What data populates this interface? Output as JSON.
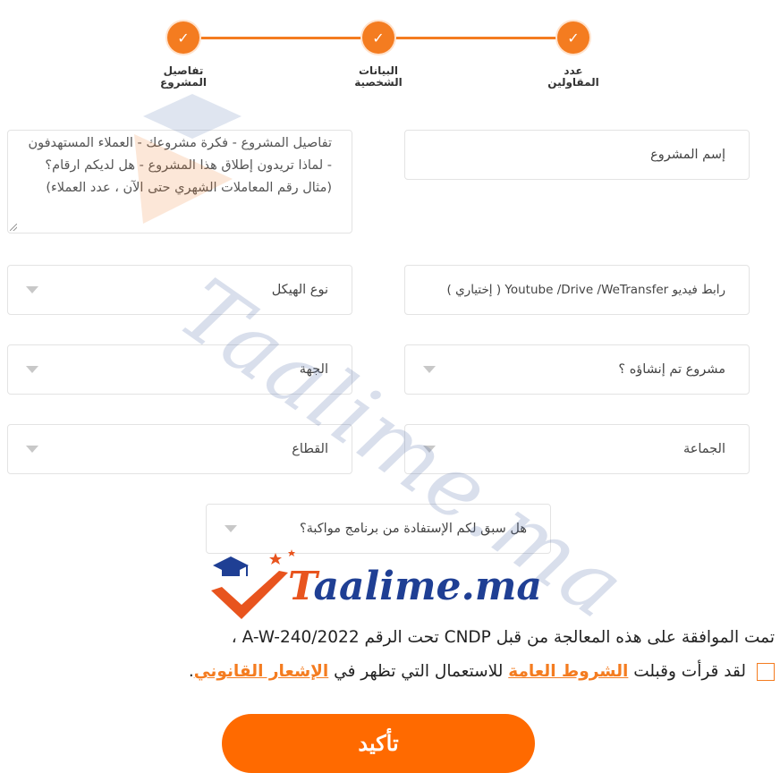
{
  "stepper": {
    "steps": [
      {
        "label": "تفاصيل\nالمشروع",
        "status": "done"
      },
      {
        "label": "البيانات\nالشخصية",
        "status": "done"
      },
      {
        "label": "عدد\nالمقاولين",
        "status": "done"
      }
    ],
    "check_glyph": "✓",
    "accent": "#f47c20"
  },
  "form": {
    "project_name": {
      "placeholder": "إسم المشروع"
    },
    "project_details": {
      "placeholder": "تفاصيل المشروع - فكرة مشروعك - العملاء المستهدفون - لماذا تريدون إطلاق هذا المشروع - هل لديكم ارقام؟ (مثال رقم المعاملات الشهري حتى الآن ، عدد العملاء)"
    },
    "video_link": {
      "placeholder": "رابط فيديو Youtube /Drive /WeTransfer ( إختياري )"
    },
    "structure_type": {
      "value": "نوع الهيكل"
    },
    "project_created": {
      "value": "مشروع تم إنشاؤه ؟"
    },
    "region": {
      "value": "الجهة"
    },
    "commune": {
      "value": "الجماعة"
    },
    "sector": {
      "value": "القطاع"
    },
    "mentoring": {
      "value": "هل سبق لكم الإستفادة من برنامج مواكبة؟"
    }
  },
  "logo": {
    "text_first": "T",
    "text_rest": "aalime.ma",
    "brand_blue": "#1f3f94",
    "brand_orange": "#e8541e"
  },
  "watermark": {
    "text": "Taalime.ma"
  },
  "agreement": {
    "cndp_text": "تمت الموافقة على هذه المعالجة من قبل CNDP تحت الرقم A-W-240/2022 ،",
    "read_accept": "لقد قرأت وقبلت",
    "terms_link": "الشروط العامة",
    "usage_text": "للاستعمال التي تظهر في",
    "legal_link": "الإشعار القانوني",
    "end": "."
  },
  "confirm_button": {
    "label": "تأكيد",
    "color": "#ff6a00"
  }
}
